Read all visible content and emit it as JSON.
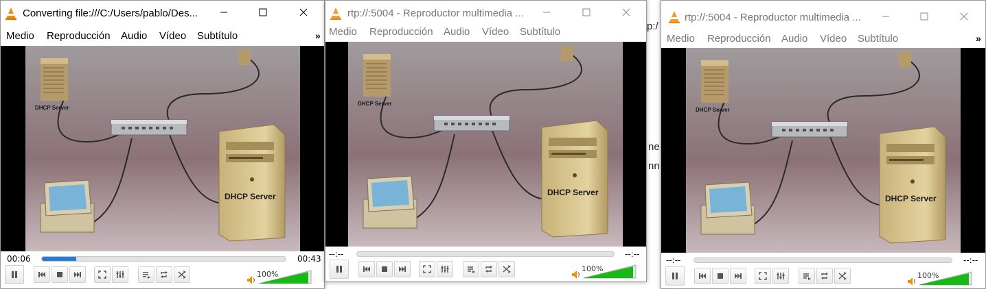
{
  "background_fragments": [
    "p:/",
    "ne",
    "nn"
  ],
  "windows": [
    {
      "title": "Converting file:///C:/Users/pablo/Des...",
      "menu": [
        "Medio",
        "Reproducción",
        "Audio",
        "Vídeo",
        "Subtítulo"
      ],
      "menu_more": "»",
      "time_elapsed": "00:06",
      "time_total": "00:43",
      "progress": 0.14,
      "volume": "100%",
      "active": true
    },
    {
      "title": "rtp://:5004 - Reproductor multimedia ...",
      "menu": [
        "Medio",
        "Reproducción",
        "Audio",
        "Vídeo",
        "Subtítulo"
      ],
      "menu_more": "»",
      "time_elapsed": "--:--",
      "time_total": "--:--",
      "progress": 0,
      "volume": "100%",
      "active": false
    },
    {
      "title": "rtp://:5004 - Reproductor multimedia ...",
      "menu": [
        "Medio",
        "Reproducción",
        "Audio",
        "Vídeo",
        "Subtítulo"
      ],
      "menu_more": "»",
      "time_elapsed": "--:--",
      "time_total": "--:--",
      "progress": 0,
      "volume": "100%",
      "active": false
    }
  ],
  "video_labels": {
    "small_server": "DHCP Server",
    "tower_server": "DHCP Server"
  },
  "colors": {
    "accent_progress": "#2a7bd3",
    "volume_green": "#18b818",
    "vlc_orange": "#f28c00"
  }
}
